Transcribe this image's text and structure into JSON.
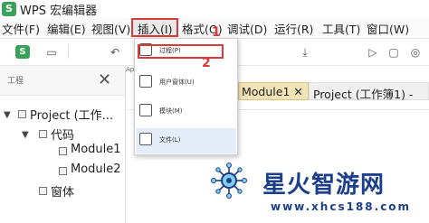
{
  "app": {
    "logo_letter": "S",
    "title": "WPS 宏编辑器"
  },
  "menu": {
    "items": [
      "文件(F)",
      "编辑(E)",
      "视图(V)",
      "插入(I)",
      "格式(O)",
      "调试(D)",
      "运行(R)",
      "工具(T)",
      "窗口(W)"
    ]
  },
  "toolbar": {
    "icons": [
      "wps-logo-icon",
      "save-icon",
      "undo-icon",
      "run-icon",
      "stop-icon"
    ]
  },
  "project_panel": {
    "title": "工程",
    "tree": {
      "project": "Project (工作...",
      "folder_code": "代码",
      "module1": "Module1",
      "module2": "Module2",
      "folder_forms": "窗体"
    },
    "left_marker": "Ap"
  },
  "editor": {
    "tabs": [
      "Module1 ✕",
      "Project (工作簿1) -"
    ]
  },
  "insert_menu": {
    "items": [
      {
        "label": "过程(P)",
        "icon": "procedure-icon"
      },
      {
        "label": "用户窗体(U)",
        "icon": "userform-icon"
      },
      {
        "label": "模块(M)",
        "icon": "module-icon"
      },
      {
        "label": "文件(L)",
        "icon": "file-icon"
      }
    ]
  },
  "annotations": {
    "step1": "1",
    "step2": "2"
  },
  "watermark": {
    "text": "星火智游网",
    "url": "www.xhcs188.com"
  },
  "colors": {
    "highlight": "#d93a3a",
    "tab_active": "#f3e4b6",
    "watermark": "#1b3f8a"
  }
}
